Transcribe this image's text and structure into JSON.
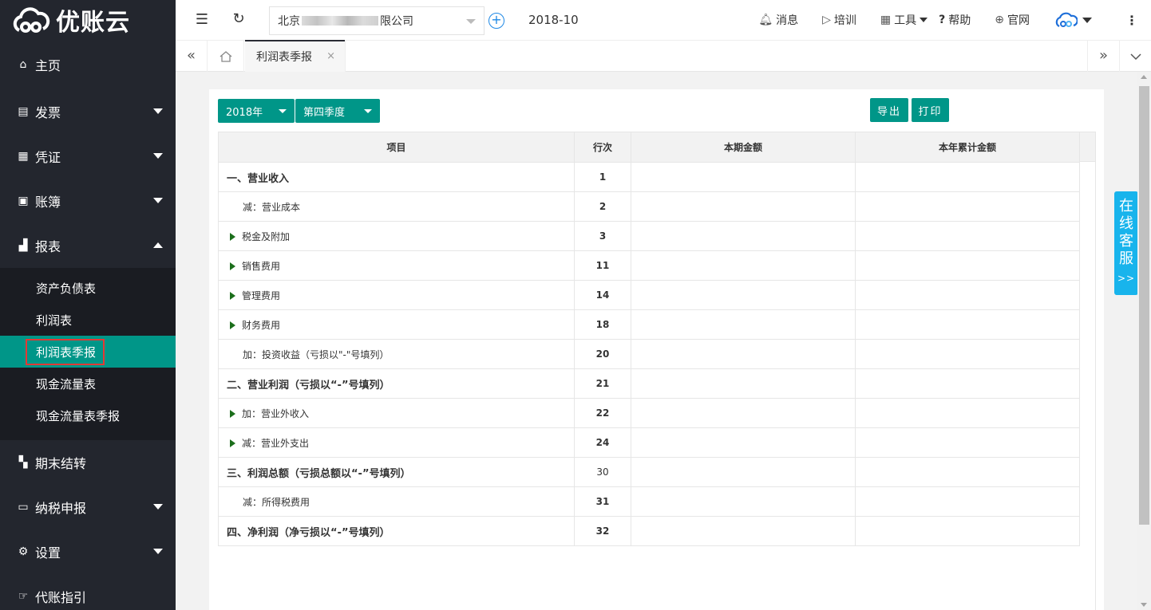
{
  "brand": {
    "name": "优账云"
  },
  "sidebar": {
    "items": [
      {
        "label": "主页",
        "icon": "home-icon"
      },
      {
        "label": "发票",
        "icon": "invoice-icon"
      },
      {
        "label": "凭证",
        "icon": "voucher-icon"
      },
      {
        "label": "账簿",
        "icon": "ledger-icon"
      },
      {
        "label": "报表",
        "icon": "report-icon"
      },
      {
        "label": "期末结转",
        "icon": "period-close-icon"
      },
      {
        "label": "纳税申报",
        "icon": "tax-icon"
      },
      {
        "label": "设置",
        "icon": "gear-icon"
      },
      {
        "label": "代账指引",
        "icon": "guide-icon"
      }
    ],
    "report_submenu": [
      {
        "label": "资产负债表"
      },
      {
        "label": "利润表"
      },
      {
        "label": "利润表季报",
        "active": true
      },
      {
        "label": "现金流量表"
      },
      {
        "label": "现金流量表季报"
      }
    ]
  },
  "topbar": {
    "company_prefix": "北京",
    "company_suffix": "限公司",
    "period": "2018-10",
    "messages": "消息",
    "training": "培训",
    "tools": "工具",
    "help": "帮助",
    "website": "官网"
  },
  "tabs": {
    "active_label": "利润表季报",
    "close": "×"
  },
  "filters": {
    "year": "2018年",
    "quarter": "第四季度",
    "export": "导出",
    "print": "打印"
  },
  "table": {
    "headers": [
      "项目",
      "行次",
      "本期金额",
      "本年累计金额"
    ],
    "rows": [
      {
        "item": "一、营业收入",
        "line": "1",
        "level": "top",
        "expandable": false
      },
      {
        "item": "减：营业成本",
        "line": "2",
        "level": "sub",
        "expandable": false
      },
      {
        "item": "税金及附加",
        "line": "3",
        "level": "sub",
        "expandable": true
      },
      {
        "item": "销售费用",
        "line": "11",
        "level": "sub",
        "expandable": true
      },
      {
        "item": "管理费用",
        "line": "14",
        "level": "sub",
        "expandable": true
      },
      {
        "item": "财务费用",
        "line": "18",
        "level": "sub",
        "expandable": true
      },
      {
        "item": "加：投资收益（亏损以\"-\"号填列）",
        "line": "20",
        "level": "sub",
        "expandable": false
      },
      {
        "item": "二、营业利润（亏损以“-”号填列）",
        "line": "21",
        "level": "top",
        "expandable": false
      },
      {
        "item": "加：营业外收入",
        "line": "22",
        "level": "sub",
        "expandable": true
      },
      {
        "item": "减：营业外支出",
        "line": "24",
        "level": "sub",
        "expandable": true
      },
      {
        "item": "三、利润总额（亏损总额以“-”号填列）",
        "line": "30",
        "level": "top",
        "expandable": false,
        "line_normal": true
      },
      {
        "item": "减：所得税费用",
        "line": "31",
        "level": "sub",
        "expandable": false
      },
      {
        "item": "四、净利润（净亏损以“-”号填列）",
        "line": "32",
        "level": "top",
        "expandable": false
      }
    ]
  },
  "service": {
    "chars": [
      "在",
      "线",
      "客",
      "服"
    ],
    "arrow": ">>"
  },
  "colors": {
    "sidebar_bg": "#23262e",
    "accent": "#009688",
    "service": "#18b4ec"
  }
}
